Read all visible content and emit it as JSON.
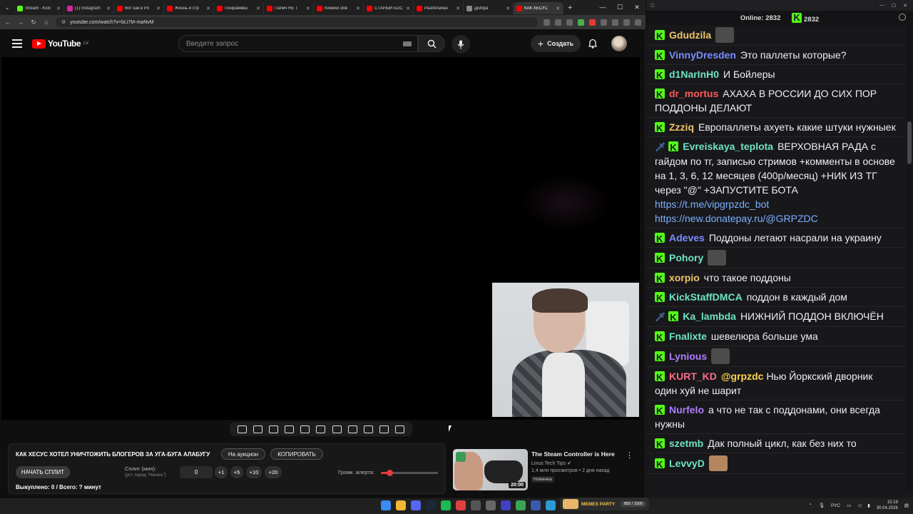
{
  "browser": {
    "tabs": [
      {
        "title": "Stream - Kick",
        "color": "#53fc18",
        "active": false
      },
      {
        "title": "(1) Instagram",
        "color": "#d6249f",
        "active": false
      },
      {
        "title": "Вот как в Ро",
        "color": "#ff0000",
        "active": false
      },
      {
        "title": "Жизнь и стр",
        "color": "#ff0000",
        "active": false
      },
      {
        "title": "Понравивш",
        "color": "#ff0000",
        "active": false
      },
      {
        "title": "Папич НЕ Т",
        "color": "#ff0000",
        "active": false
      },
      {
        "title": "Комики обв",
        "color": "#ff0000",
        "active": false
      },
      {
        "title": "СТАРЫЙ БОС",
        "color": "#ff0000",
        "active": false
      },
      {
        "title": "Разоблачен",
        "color": "#ff0000",
        "active": false
      },
      {
        "title": "ДЫбра",
        "color": "#888888",
        "active": false
      },
      {
        "title": "КАК ХЕСУС",
        "color": "#ff0000",
        "active": true
      }
    ],
    "url": "youtube.com/watch?v=bLi7M-maNvM"
  },
  "youtube": {
    "logo_word": "YouTube",
    "region": "LV",
    "search_placeholder": "Введите запрос",
    "create_label": "Создать"
  },
  "panel": {
    "title": "КАК ХЕСУС ХОТЕЛ УНИЧТОЖИТЬ БЛОГЕРОВ ЗА УГА-БУГА АЛАБУГУ",
    "auction_label": "На аукцион",
    "copy_label": "КОПИРОВАТЬ",
    "start_split_label": "НАЧАТЬ СПЛИТ",
    "split_label": "Сплит (мин):",
    "split_sub": "(уст. перед \"Начать\")",
    "split_value": "0",
    "steps": [
      "+1",
      "+5",
      "+10",
      "+20"
    ],
    "volume_label": "Громк. алерта:",
    "volume_level": 0.15,
    "done_text": "Выкуплено: 0 / Всего: ? минут"
  },
  "recommended": {
    "title": "The Steam Controller is Here",
    "channel": "Linus Tech Tips",
    "meta": "1,4 млн просмотров • 2 дня назад",
    "badge": "Новинка",
    "duration": "20:00"
  },
  "chat": {
    "online_label": "Online:",
    "online_count": "2832",
    "viewers_count": "2832",
    "messages": [
      {
        "user": "Gdudzila",
        "color": "#f0c46a",
        "text": "",
        "emote": "gray",
        "sword": false
      },
      {
        "user": "VinnyDresden",
        "color": "#7c8cff",
        "text": "Это паллеты которые?",
        "emote": "",
        "sword": false
      },
      {
        "user": "d1NarInH0",
        "color": "#6fe3c5",
        "text": "И Бойлеры",
        "emote": "",
        "sword": false
      },
      {
        "user": "dr_mortus",
        "color": "#ff5a5a",
        "text": "АХАХА В РОССИИ ДО СИХ ПОР ПОДДОНЫ ДЕЛАЮТ",
        "emote": "",
        "sword": false
      },
      {
        "user": "Zzziq",
        "color": "#f0c46a",
        "text": "Европаллеты ахуеть какие штуки нужныек",
        "emote": "",
        "sword": false
      },
      {
        "user": "Evreiskaya_teplota",
        "color": "#6fe3c5",
        "text": "ВЕРХОВНАЯ РАДА с гайдом по тг, записью стримов +комменты в основе на 1, 3, 6, 12 месяцев (400р/месяц) +НИК ИЗ ТГ через \"@\" +ЗАПУСТИТЕ БОТА",
        "link1": "https://t.me/vipgrpzdc_bot",
        "link2": "https://new.donatepay.ru/@GRPZDC",
        "emote": "pepe",
        "sword": true
      },
      {
        "user": "Adeves",
        "color": "#7c8cff",
        "text": "Поддоны летают насрали на украину",
        "emote": "",
        "sword": false
      },
      {
        "user": "Pohory",
        "color": "#6fe3c5",
        "text": "",
        "emote": "gray",
        "sword": false
      },
      {
        "user": "xorpio",
        "color": "#f0c46a",
        "text": "что такое поддоны",
        "emote": "",
        "sword": false
      },
      {
        "user": "KickStaffDMCA",
        "color": "#6fe3c5",
        "text": "поддон в каждый дом",
        "emote": "",
        "sword": false
      },
      {
        "user": "Ka_lambda",
        "color": "#6fe3c5",
        "text": "НИЖНИЙ ПОДДОН ВКЛЮЧЁН",
        "emote": "",
        "sword": true
      },
      {
        "user": "Fnalixte",
        "color": "#6fe3c5",
        "text": "шевелюра больше ума",
        "emote": "",
        "sword": false
      },
      {
        "user": "Lynious",
        "color": "#b07cff",
        "text": "",
        "emote": "gray",
        "sword": false
      },
      {
        "user": "KURT_KD",
        "color": "#ff6b8a",
        "mention": "@grpzdc",
        "text": "Нью Йоркский дворник один хуй не шарит",
        "emote": "",
        "sword": false
      },
      {
        "user": "Nurfelo",
        "color": "#b07cff",
        "text": "а что не так с поддонами, они всегда нужны",
        "emote": "",
        "sword": false
      },
      {
        "user": "szetmb",
        "color": "#6fe3c5",
        "text": "Дак полный цикл, как без них то",
        "emote": "",
        "sword": false
      },
      {
        "user": "LevvyD",
        "color": "#6fe3c5",
        "text": "",
        "emote": "face",
        "sword": false
      }
    ]
  },
  "taskbar": {
    "widget_title": "MEMES PARTY",
    "widget_value": "855 / 1500",
    "lang": "РУС",
    "time": "15:19",
    "date": "30.04.2026"
  }
}
